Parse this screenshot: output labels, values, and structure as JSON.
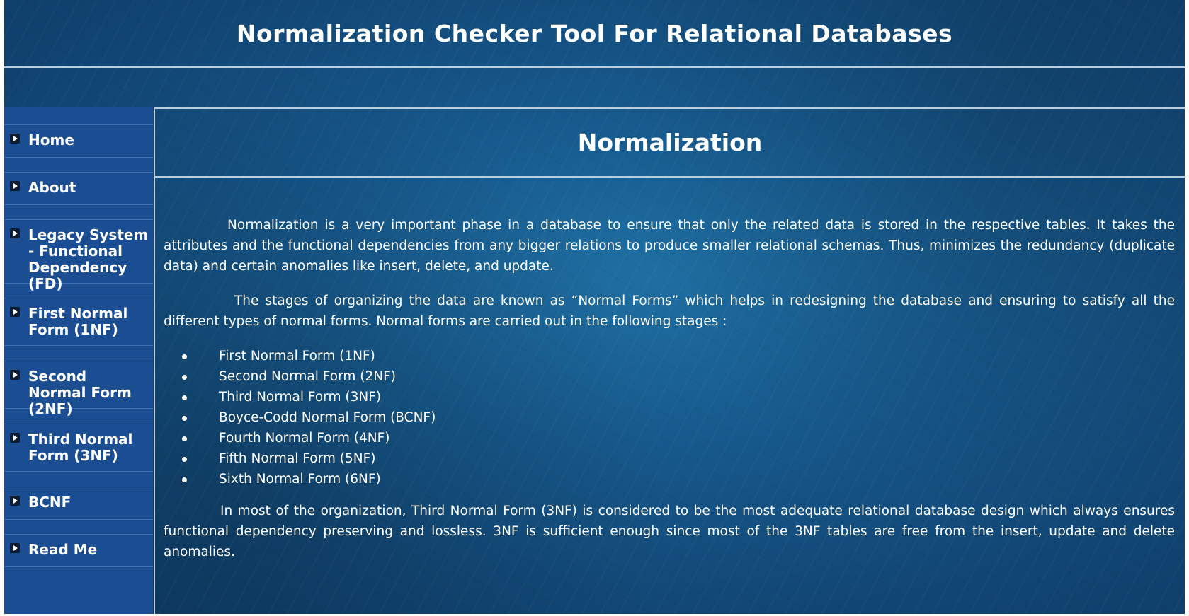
{
  "header": {
    "title": "Normalization Checker Tool For Relational Databases"
  },
  "sidebar": {
    "items": [
      {
        "label": "Home"
      },
      {
        "label": "About"
      },
      {
        "label": "Legacy System - Functional Dependency (FD)"
      },
      {
        "label": "First Normal Form (1NF)"
      },
      {
        "label": "Second Normal Form (2NF)"
      },
      {
        "label": "Third Normal Form (3NF)"
      },
      {
        "label": "BCNF"
      },
      {
        "label": "Read Me"
      }
    ]
  },
  "main": {
    "title": "Normalization",
    "paragraph1": "Normalization is a very important phase in a database to ensure that only the related data is stored in the respective tables. It takes the attributes and the functional dependencies from any bigger relations to produce smaller relational schemas. Thus, minimizes the redundancy (duplicate data) and certain anomalies like insert, delete, and update.",
    "paragraph2": "The stages of organizing the data are known as “Normal Forms” which helps in redesigning the database and ensuring to satisfy all the different types of normal forms. Normal forms are carried out in the following stages :",
    "stages": [
      "First Normal Form (1NF)",
      "Second Normal Form (2NF)",
      "Third Normal Form (3NF)",
      "Boyce-Codd Normal Form (BCNF)",
      "Fourth Normal Form (4NF)",
      "Fifth Normal Form (5NF)",
      "Sixth Normal Form (6NF)"
    ],
    "paragraph3": "In most of the organization, Third Normal Form (3NF) is considered to be the most adequate relational database design which always ensures functional dependency preserving and lossless. 3NF is sufficient enough since most of the 3NF tables are free from the insert, update and delete anomalies."
  }
}
